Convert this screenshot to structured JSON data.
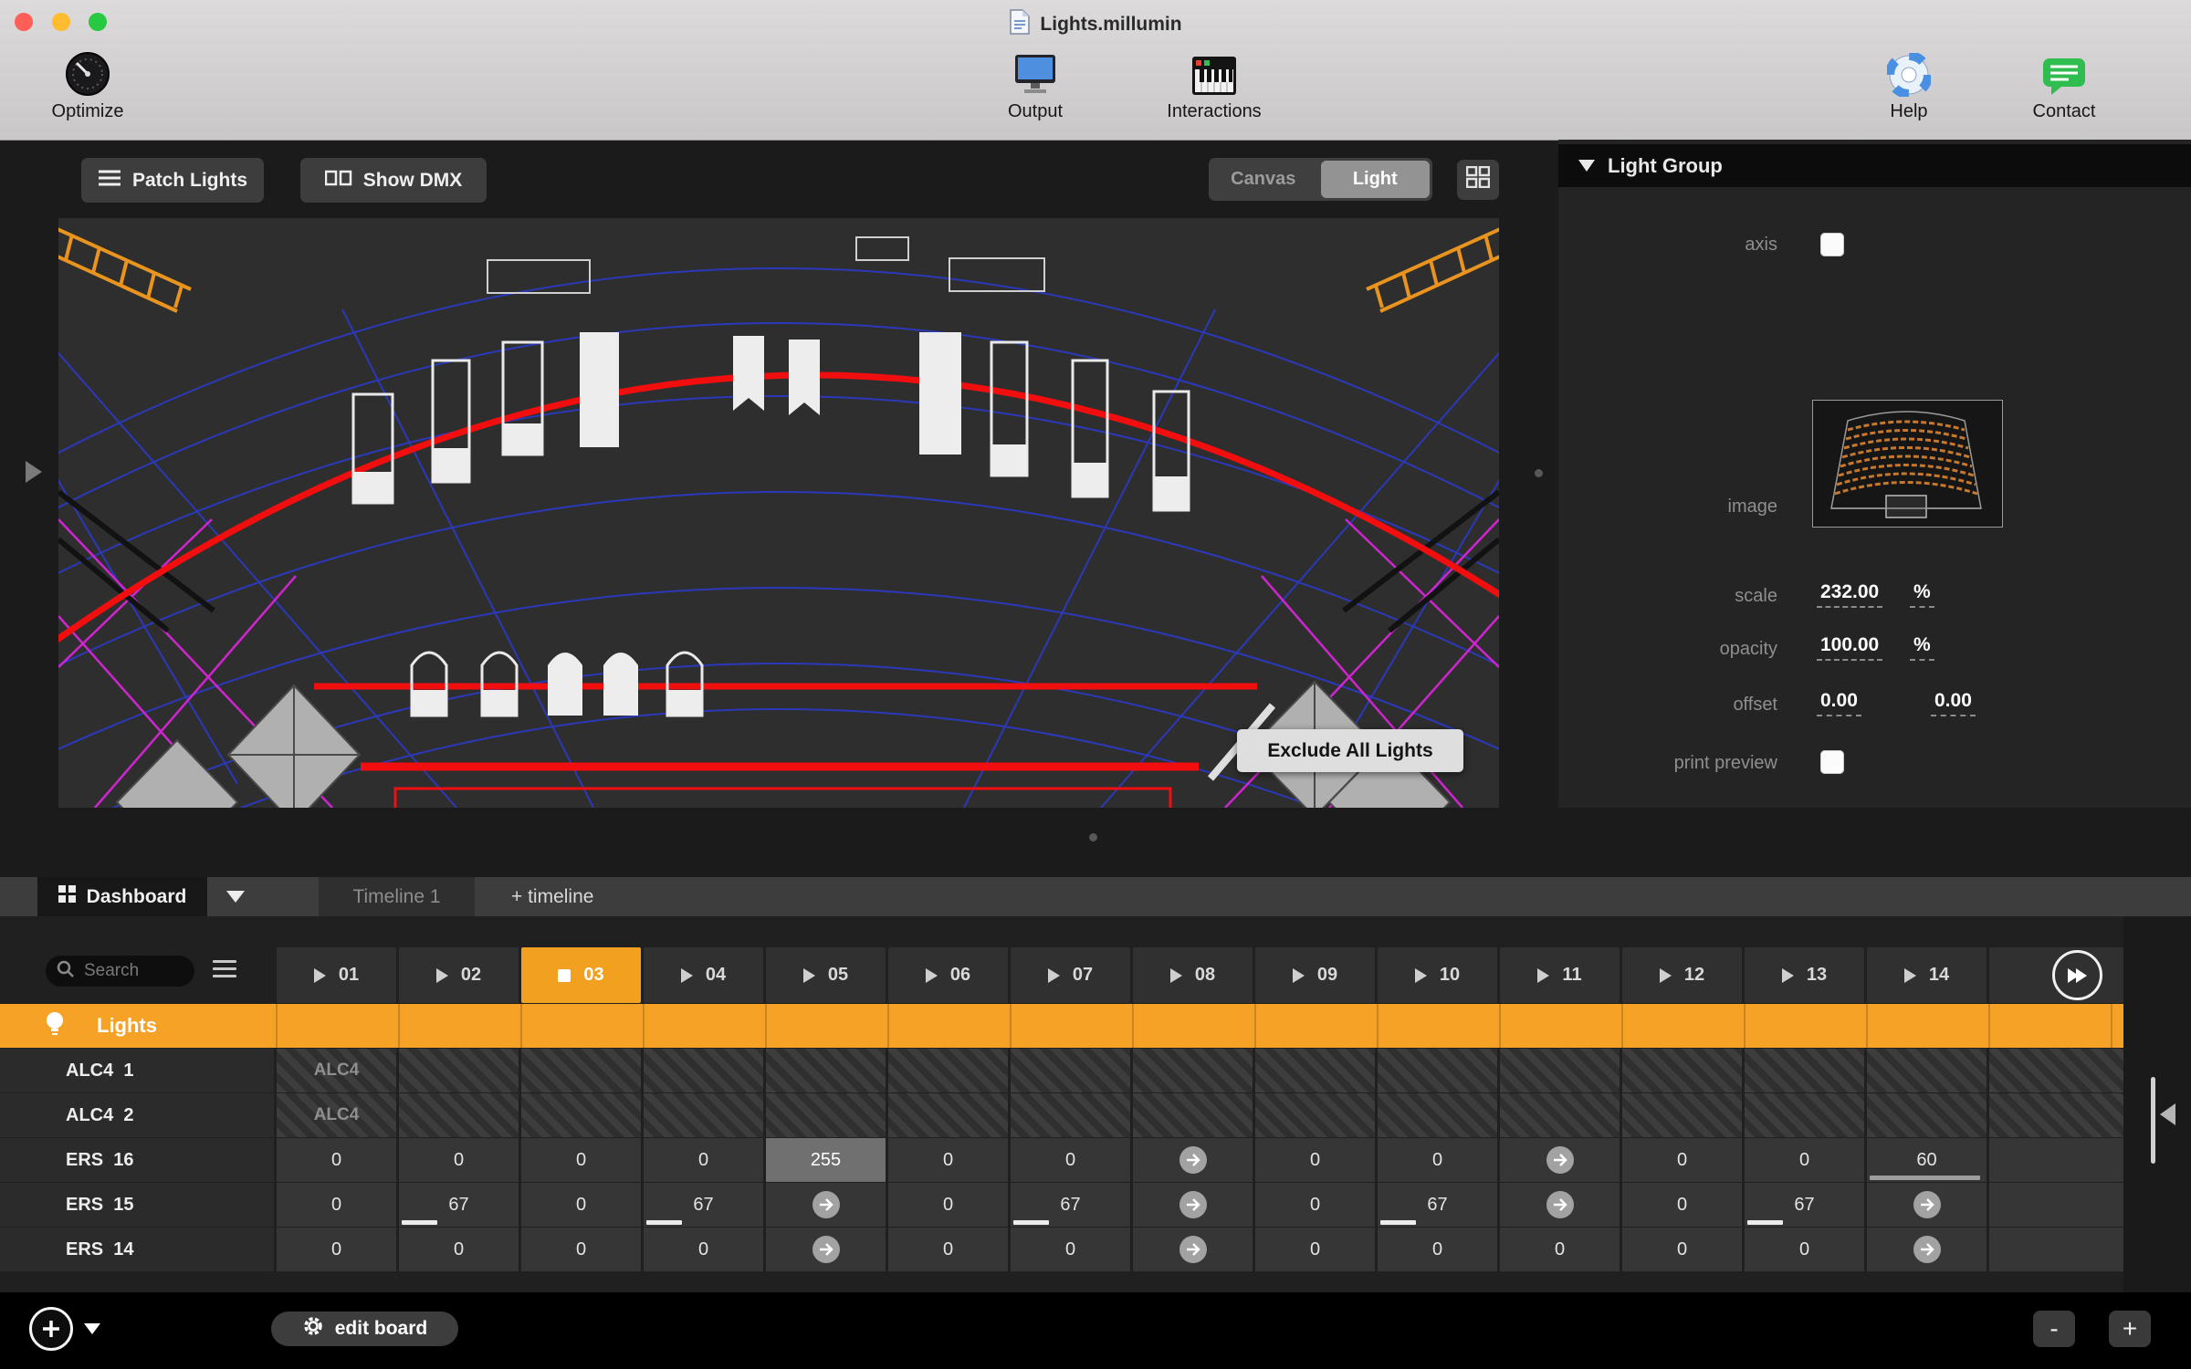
{
  "window": {
    "title": "Lights.millumin"
  },
  "toolbar": {
    "optimize_label": "Optimize",
    "output_label": "Output",
    "interactions_label": "Interactions",
    "help_label": "Help",
    "contact_label": "Contact"
  },
  "canvas_toolbar": {
    "patch_lights_label": "Patch Lights",
    "show_dmx_label": "Show DMX",
    "segment_canvas": "Canvas",
    "segment_light": "Light",
    "selected_segment": "Light"
  },
  "canvas": {
    "exclude_all_lights_label": "Exclude All Lights"
  },
  "light_group": {
    "title": "Light Group",
    "axis_label": "axis",
    "axis_checked": false,
    "image_label": "image",
    "scale_label": "scale",
    "scale_value": "232.00",
    "scale_unit": "%",
    "opacity_label": "opacity",
    "opacity_value": "100.00",
    "opacity_unit": "%",
    "offset_label": "offset",
    "offset_x": "0.00",
    "offset_y": "0.00",
    "print_preview_label": "print preview",
    "print_preview_checked": false
  },
  "tabs": {
    "dashboard_label": "Dashboard",
    "timeline_label": "Timeline 1",
    "add_timeline_label": "+ timeline"
  },
  "dashboard": {
    "search_placeholder": "Search",
    "group_row_label": "Lights",
    "columns": [
      {
        "id": "01",
        "active": false
      },
      {
        "id": "02",
        "active": false
      },
      {
        "id": "03",
        "active": true
      },
      {
        "id": "04",
        "active": false
      },
      {
        "id": "05",
        "active": false
      },
      {
        "id": "06",
        "active": false
      },
      {
        "id": "07",
        "active": false
      },
      {
        "id": "08",
        "active": false
      },
      {
        "id": "09",
        "active": false
      },
      {
        "id": "10",
        "active": false
      },
      {
        "id": "11",
        "active": false
      },
      {
        "id": "12",
        "active": false
      },
      {
        "id": "13",
        "active": false
      },
      {
        "id": "14",
        "active": false
      }
    ],
    "rows": [
      {
        "label": "ALC4  1",
        "type": "hatched",
        "first_cell_text": "ALC4"
      },
      {
        "label": "ALC4  2",
        "type": "hatched",
        "first_cell_text": "ALC4"
      },
      {
        "label": "ERS  16",
        "type": "values",
        "cells": [
          {
            "v": "0"
          },
          {
            "v": "0"
          },
          {
            "v": "0"
          },
          {
            "v": "0"
          },
          {
            "v": "255",
            "highlighted": true
          },
          {
            "v": "0"
          },
          {
            "v": "0"
          },
          {
            "arrow": true
          },
          {
            "v": "0"
          },
          {
            "v": "0"
          },
          {
            "arrow": true
          },
          {
            "v": "0"
          },
          {
            "v": "0"
          },
          {
            "v": "60",
            "bar": 92,
            "bar_color": "#9e9e9e"
          }
        ]
      },
      {
        "label": "ERS  15",
        "type": "values",
        "cells": [
          {
            "v": "0"
          },
          {
            "v": "67",
            "bar": 30
          },
          {
            "v": "0"
          },
          {
            "v": "67",
            "bar": 30
          },
          {
            "arrow": true
          },
          {
            "v": "0"
          },
          {
            "v": "67",
            "bar": 30
          },
          {
            "arrow": true
          },
          {
            "v": "0"
          },
          {
            "v": "67",
            "bar": 30
          },
          {
            "arrow": true
          },
          {
            "v": "0"
          },
          {
            "v": "67",
            "bar": 30
          },
          {
            "arrow": true
          }
        ]
      },
      {
        "label": "ERS  14",
        "type": "values",
        "cells": [
          {
            "v": "0"
          },
          {
            "v": "0"
          },
          {
            "v": "0"
          },
          {
            "v": "0"
          },
          {
            "arrow": true
          },
          {
            "v": "0"
          },
          {
            "v": "0"
          },
          {
            "arrow": true
          },
          {
            "v": "0"
          },
          {
            "v": "0"
          },
          {
            "v": "0"
          },
          {
            "v": "0"
          },
          {
            "v": "0"
          },
          {
            "arrow": true
          }
        ]
      }
    ]
  },
  "footer": {
    "edit_board_label": "edit board",
    "zoom_out_label": "-",
    "zoom_in_label": "+"
  },
  "colors": {
    "accent_orange": "#F5A227",
    "active_column_orange": "#F2A01F",
    "traffic_red": "#FF5F57",
    "traffic_yellow": "#FEBC2E",
    "traffic_green": "#28C840"
  }
}
